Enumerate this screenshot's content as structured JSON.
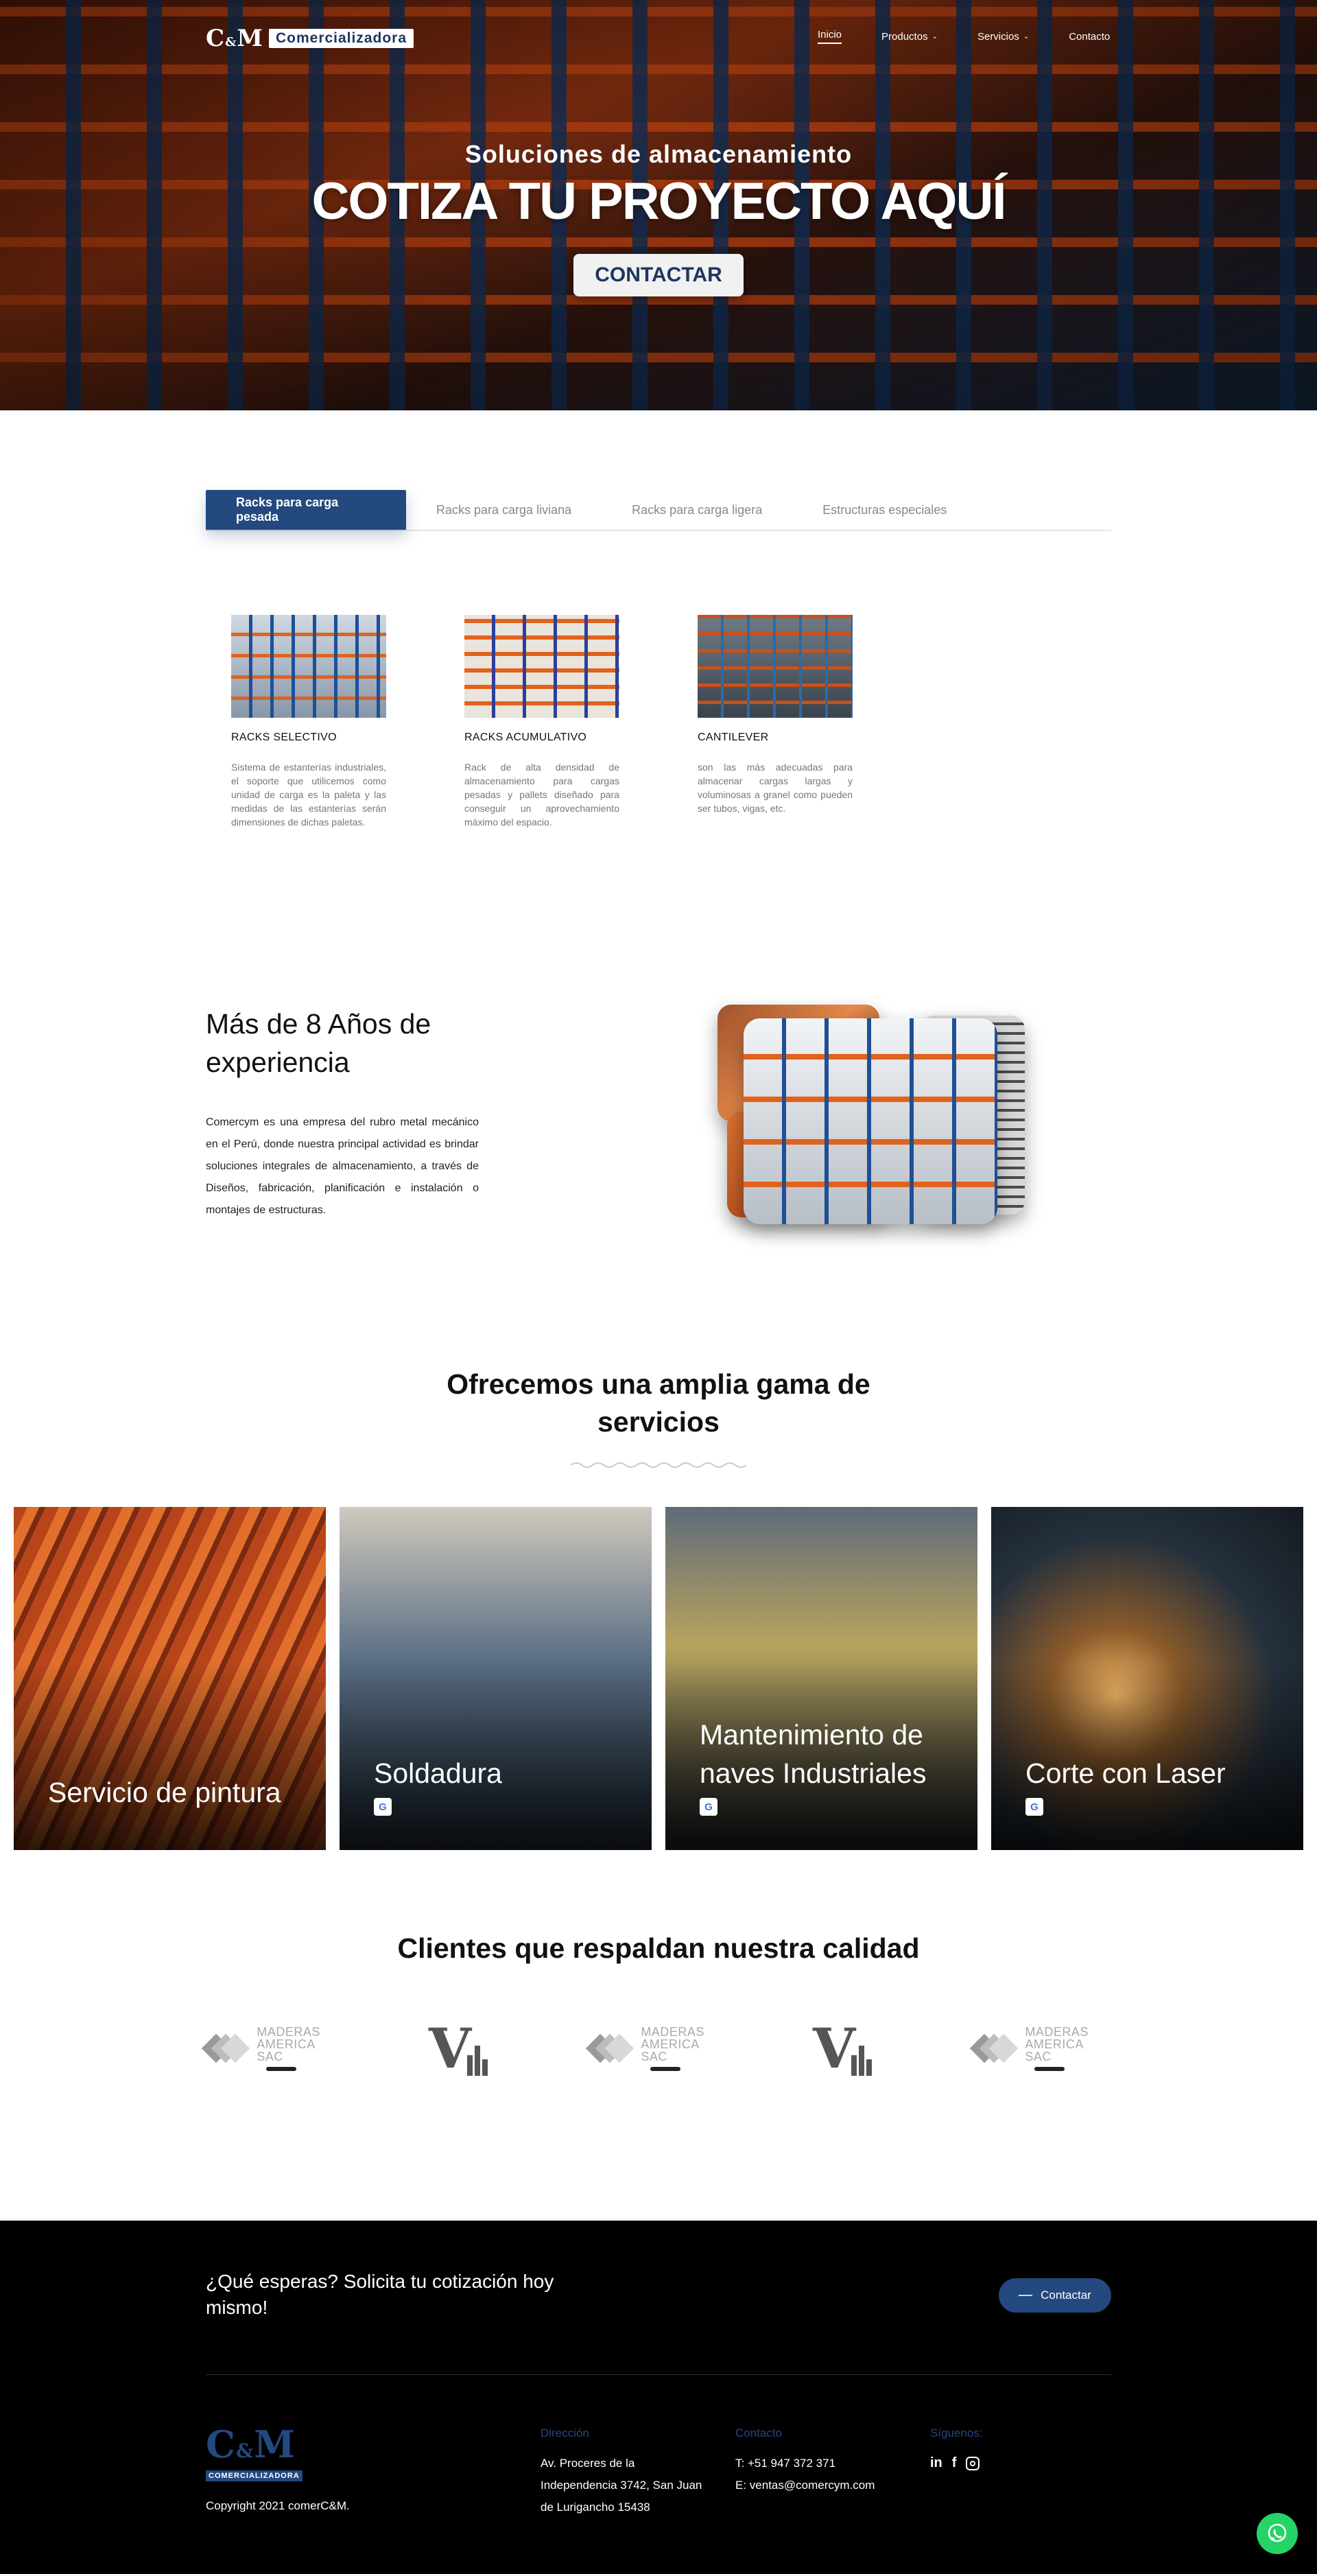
{
  "header": {
    "logo_mark": "C",
    "logo_amp": "&",
    "logo_mark2": "M",
    "logo_word": "Comercializadora",
    "nav": [
      {
        "label": "Inicio"
      },
      {
        "label": "Productos"
      },
      {
        "label": "Servicios"
      },
      {
        "label": "Contacto"
      }
    ]
  },
  "hero": {
    "subtitle": "Soluciones de almacenamiento",
    "title": "COTIZA TU PROYECTO AQUÍ",
    "button": "CONTACTAR"
  },
  "tabs": [
    {
      "label": "Racks para carga pesada"
    },
    {
      "label": "Racks para carga liviana"
    },
    {
      "label": "Racks para carga ligera"
    },
    {
      "label": "Estructuras especiales"
    }
  ],
  "products": [
    {
      "title": "RACKS SELECTIVO",
      "text": "Sistema de estanterías industriales, el soporte que utilicemos como unidad de carga es la paleta y las medidas de las estanterías serán dimensiones de dichas paletas."
    },
    {
      "title": "RACKS ACUMULATIVO",
      "text": "Rack de alta densidad de almacenamiento para cargas pesadas y pallets diseñado para conseguir un aprovechamiento máximo del espacio."
    },
    {
      "title": "CANTILEVER",
      "text": "son las más adecuadas para almacenar cargas largas y voluminosas a granel como pueden ser tubos, vigas, etc."
    }
  ],
  "experience": {
    "title": "Más de 8 Años de experiencia",
    "text": "Comercym es una empresa del rubro metal mecánico en el Perú, donde nuestra principal actividad es brindar soluciones integrales de almacenamiento, a través de Diseños, fabricación, planificación e instalación o montajes de estructuras."
  },
  "services": {
    "title": "Ofrecemos una amplia gama de servicios",
    "items": [
      {
        "label": "Servicio de pintura"
      },
      {
        "label": "Soldadura"
      },
      {
        "label": "Mantenimiento de naves Industriales"
      },
      {
        "label": "Corte con Laser"
      }
    ]
  },
  "clients": {
    "title": "Clientes que respaldan nuestra calidad",
    "maderas_line1": "MADERAS",
    "maderas_line2": "AMERICA SAC",
    "v_letter": "V"
  },
  "footer": {
    "cta_text": "¿Qué esperas? Solicita tu cotización hoy mismo!",
    "cta_button": "Contactar",
    "logo_mark": "C",
    "logo_amp": "&",
    "logo_mark2": "M",
    "logo_word": "COMERCIALIZADORA",
    "copyright": "Copyright 2021 comerC&M.",
    "address_title": "Dirección",
    "address": "Av. Proceres de la Independencia 3742, San Juan de Lurigancho 15438",
    "contact_title": "Contacto",
    "phone": "T: +51 947 372 371",
    "email": "E: ventas@comercym.com",
    "social_title": "Síguenos:",
    "social_linkedin": "in",
    "social_facebook": "f"
  },
  "colors": {
    "brand_blue": "#23497f",
    "accent_orange": "#e2621c",
    "whatsapp_green": "#25d366"
  },
  "icons": {
    "translate": "google-translate-icon",
    "whatsapp": "whatsapp-icon",
    "nav_chevron": "chevron-down-icon"
  }
}
